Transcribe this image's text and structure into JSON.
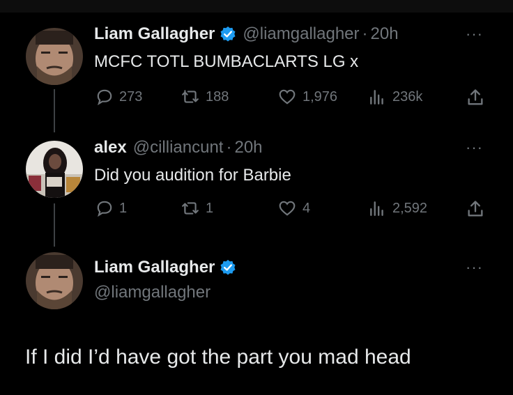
{
  "tweet1": {
    "name": "Liam Gallagher",
    "handle": "@liamgallagher",
    "separator": "·",
    "time": "20h",
    "text": "MCFC TOTL BUMBACLARTS LG x",
    "replies": "273",
    "retweets": "188",
    "likes": "1,976",
    "views": "236k"
  },
  "tweet2": {
    "name": "alex",
    "handle": "@cilliancunt",
    "separator": "·",
    "time": "20h",
    "text": "Did you audition for Barbie",
    "replies": "1",
    "retweets": "1",
    "likes": "4",
    "views": "2,592"
  },
  "tweet3": {
    "name": "Liam Gallagher",
    "handle": "@liamgallagher",
    "text": "If I did I’d have got the part you mad head"
  },
  "more_label": "···",
  "colors": {
    "background": "#000000",
    "text": "#e7e9ea",
    "muted": "#71767b",
    "verified": "#1d9bf0"
  }
}
